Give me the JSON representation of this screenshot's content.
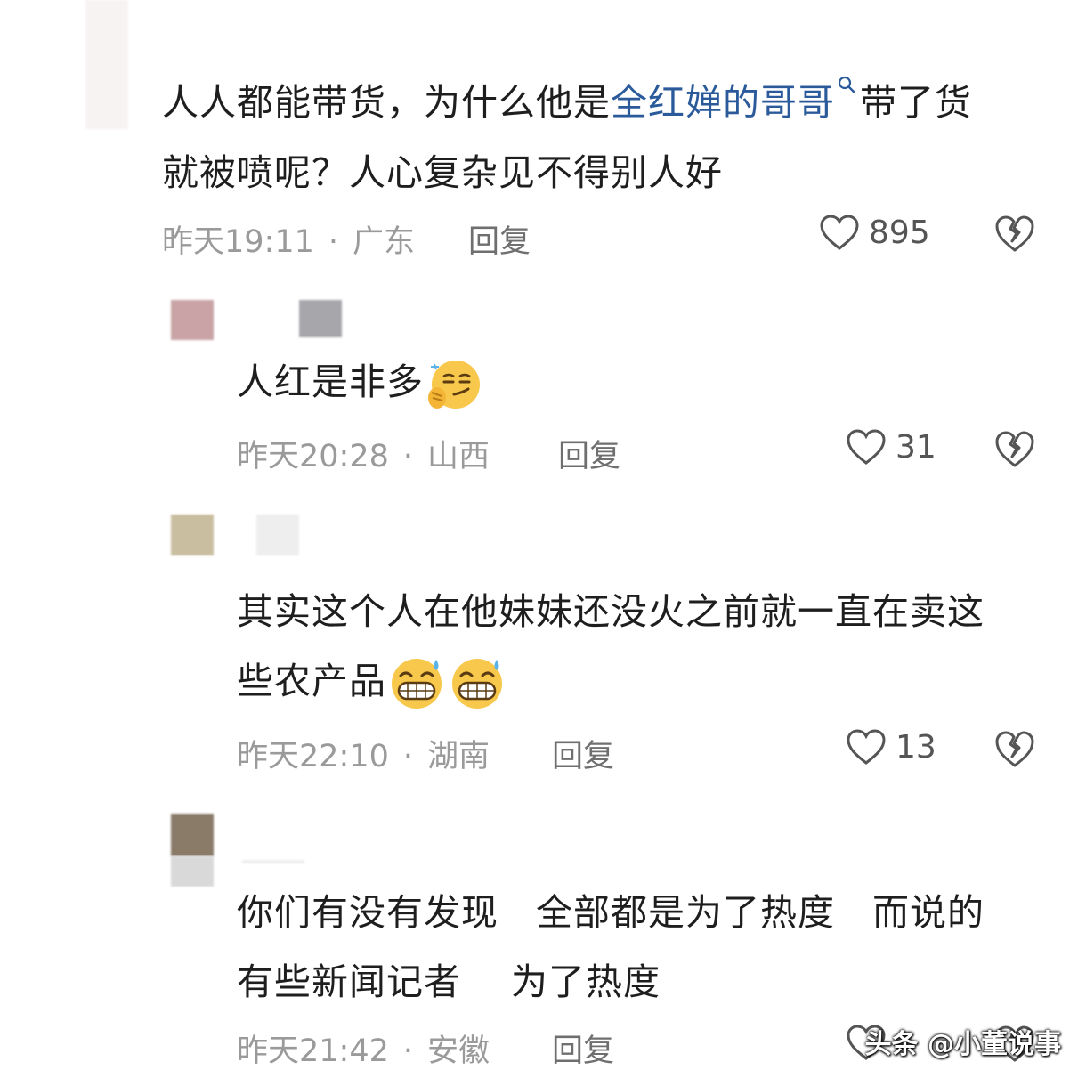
{
  "comments": [
    {
      "text_before": "人人都能带货，为什么他是",
      "link_text": "全红婵的哥哥",
      "text_after_line1": "带了货",
      "text_line2": "就被喷呢？人心复杂见不得别人好",
      "time": "昨天19:11",
      "location": "广东",
      "reply_label": "回复",
      "likes": "895"
    },
    {
      "text_line1": "人红是非多",
      "emoji": "smirk-emoji",
      "time": "昨天20:28",
      "location": "山西",
      "reply_label": "回复",
      "likes": "31"
    },
    {
      "text_line1": "其实这个人在他妹妹还没火之前就一直在卖这",
      "text_line2": "些农产品",
      "emoji": "sweat-grin-emoji",
      "time": "昨天22:10",
      "location": "湖南",
      "reply_label": "回复",
      "likes": "13"
    },
    {
      "text_line1": "你们有没有发现　全部都是为了热度　而说的",
      "text_line2": "有些新闻记者　 为了热度",
      "time": "昨天21:42",
      "location": "安徽",
      "reply_label": "回复"
    }
  ],
  "separator": "·",
  "watermark": "头条 @小董说事",
  "colors": {
    "link": "#2b5a9b",
    "meta": "#9a9a9a"
  }
}
